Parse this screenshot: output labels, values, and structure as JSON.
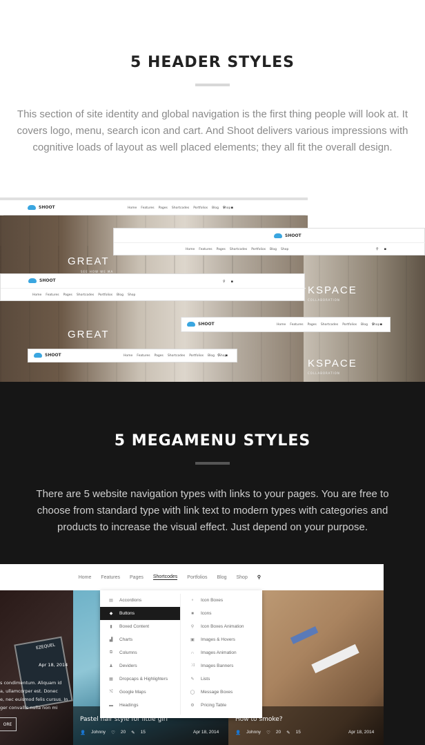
{
  "section1": {
    "title": "5 HEADER STYLES",
    "paragraph": "This section of site identity and global navigation is the first thing people will look at. It covers logo, menu, search icon and cart. And Shoot delivers various impressions with cognitive loads of layout as well placed elements; they all fit the overall design."
  },
  "headers": {
    "brand": "SHOOT",
    "nav": [
      "Home",
      "Features",
      "Pages",
      "Shortcodes",
      "Portfolios",
      "Blog",
      "Shop"
    ],
    "hero1": "GREAT",
    "hero1_sub": "SEE HOW WE MA",
    "hero2": "KSPACE",
    "hero2_sub": "COLLABORATION",
    "hero3": "GREAT",
    "hero4": "KSPACE",
    "hero4_sub": "COLLABORATION"
  },
  "section2": {
    "title": "5 MEGAMENU STYLES",
    "paragraph": "There are 5 website navigation types with links to your pages. You are free to choose from standard type with link text to modern types with categories and products to increase the visual effect.  Just depend on your purpose."
  },
  "megamenu": {
    "nav": [
      "Home",
      "Features",
      "Pages",
      "Shortcodes",
      "Portfolios",
      "Blog",
      "Shop"
    ],
    "col1": [
      {
        "label": "Accordions",
        "icon": "accordion-icon"
      },
      {
        "label": "Buttons",
        "icon": "button-icon"
      },
      {
        "label": "Boxed Content",
        "icon": "box-icon"
      },
      {
        "label": "Charts",
        "icon": "chart-icon"
      },
      {
        "label": "Columns",
        "icon": "columns-icon"
      },
      {
        "label": "Deviders",
        "icon": "divider-icon"
      },
      {
        "label": "Dropcaps & Highlighters",
        "icon": "dropcap-icon"
      },
      {
        "label": "Google Maps",
        "icon": "map-icon"
      },
      {
        "label": "Headings",
        "icon": "heading-icon"
      }
    ],
    "col2": [
      {
        "label": "Icon Boxes",
        "icon": "iconbox-icon"
      },
      {
        "label": "Icons",
        "icon": "icons-icon"
      },
      {
        "label": "Icon Boxes Animation",
        "icon": "search-icon"
      },
      {
        "label": "Images & Hovers",
        "icon": "image-icon"
      },
      {
        "label": "Images Animation",
        "icon": "magnet-icon"
      },
      {
        "label": "Images Banners",
        "icon": "shuffle-icon"
      },
      {
        "label": "Lists",
        "icon": "pencil-icon"
      },
      {
        "label": "Message Boxes",
        "icon": "message-icon"
      },
      {
        "label": "Pricing Table",
        "icon": "gears-icon"
      }
    ],
    "left_date": "Apr 18, 2014",
    "left_text1": "s condimentum. Aliquam id",
    "left_text2": "a, ullamcorper est. Donec",
    "left_text3": "e, nec euismod felis cursus. In",
    "left_text4": "ger convallis nulla non mi",
    "left_badge": "EZEQUEL",
    "left_button": "ORE",
    "post1_title": "Pastel hair style for little girl",
    "post1_author": "Johnny",
    "post1_likes": "20",
    "post1_comments": "15",
    "post1_date": "Apr 18, 2014",
    "post2_title": "How to smoke?",
    "post2_author": "Johnny",
    "post2_likes": "20",
    "post2_comments": "15",
    "post2_date": "Apr 18, 2014"
  },
  "colors": {
    "dark_bg": "#161616",
    "accent_blue": "#3aa6e0",
    "bar_light": "#d8d8d8",
    "bar_dark": "#555555"
  }
}
